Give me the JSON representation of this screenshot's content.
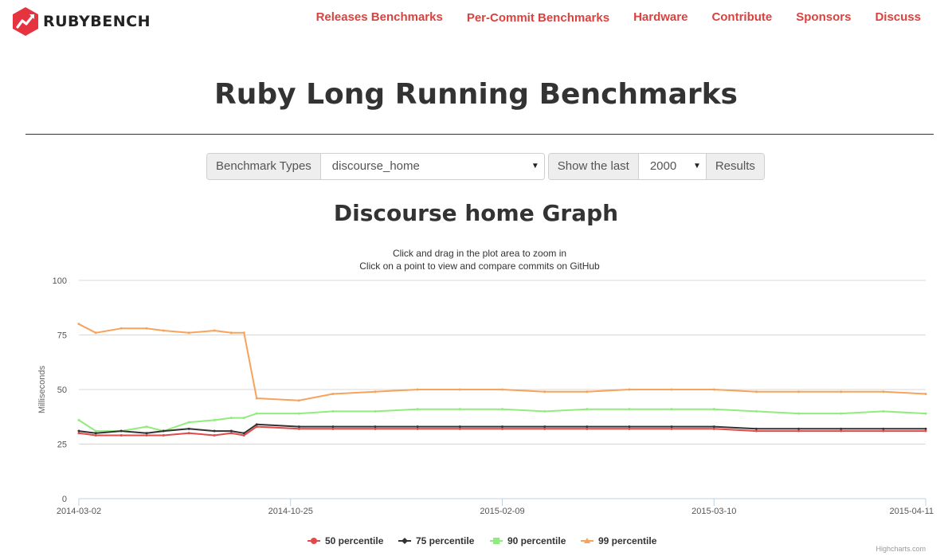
{
  "brand": {
    "name": "RUBYBENCH",
    "color": "#e5343f"
  },
  "nav": {
    "items": [
      {
        "label": "Releases Benchmarks",
        "active": false
      },
      {
        "label": "Per-Commit Benchmarks",
        "active": true
      },
      {
        "label": "Hardware",
        "active": false
      },
      {
        "label": "Contribute",
        "active": false
      },
      {
        "label": "Sponsors",
        "active": false
      },
      {
        "label": "Discuss",
        "active": false
      }
    ],
    "color": "#d9433f"
  },
  "page_title": "Ruby Long Running Benchmarks",
  "controls": {
    "benchmark_types_label": "Benchmark Types",
    "benchmark_type_value": "discourse_home",
    "show_last_label": "Show the last",
    "show_last_value": "2000",
    "results_label": "Results"
  },
  "graph_title": "Discourse home Graph",
  "chart_data": {
    "type": "line",
    "subtitle": [
      "Click and drag in the plot area to zoom in",
      "Click on a point to view and compare commits on GitHub"
    ],
    "ylabel": "Milliseconds",
    "ylim": [
      0,
      100
    ],
    "yticks": [
      0,
      25,
      50,
      75,
      100
    ],
    "xticks": [
      "2014-03-02",
      "2014-10-25",
      "2015-02-09",
      "2015-03-10",
      "2015-04-11"
    ],
    "x": [
      0,
      0.02,
      0.05,
      0.08,
      0.1,
      0.13,
      0.16,
      0.18,
      0.195,
      0.21,
      0.26,
      0.3,
      0.35,
      0.4,
      0.45,
      0.5,
      0.55,
      0.6,
      0.65,
      0.7,
      0.75,
      0.8,
      0.85,
      0.9,
      0.95,
      1.0
    ],
    "legend_position": "bottom",
    "grid": true,
    "credit": "Highcharts.com",
    "series": [
      {
        "name": "50 percentile",
        "color": "#e24a4a",
        "marker": "circle",
        "values": [
          30,
          29,
          29,
          29,
          29,
          30,
          29,
          30,
          29,
          33,
          32,
          32,
          32,
          32,
          32,
          32,
          32,
          32,
          32,
          32,
          32,
          31,
          31,
          31,
          31,
          31
        ]
      },
      {
        "name": "75 percentile",
        "color": "#333333",
        "marker": "diamond",
        "values": [
          31,
          30,
          31,
          30,
          31,
          32,
          31,
          31,
          30,
          34,
          33,
          33,
          33,
          33,
          33,
          33,
          33,
          33,
          33,
          33,
          33,
          32,
          32,
          32,
          32,
          32
        ]
      },
      {
        "name": "90 percentile",
        "color": "#90ed7d",
        "marker": "square",
        "values": [
          36,
          31,
          31,
          33,
          31,
          35,
          36,
          37,
          37,
          39,
          39,
          40,
          40,
          41,
          41,
          41,
          40,
          41,
          41,
          41,
          41,
          40,
          39,
          39,
          40,
          39
        ]
      },
      {
        "name": "99 percentile",
        "color": "#f7a35c",
        "marker": "triangle",
        "values": [
          80,
          76,
          78,
          78,
          77,
          76,
          77,
          76,
          76,
          46,
          45,
          48,
          49,
          50,
          50,
          50,
          49,
          49,
          50,
          50,
          50,
          49,
          49,
          49,
          49,
          48
        ]
      }
    ]
  }
}
